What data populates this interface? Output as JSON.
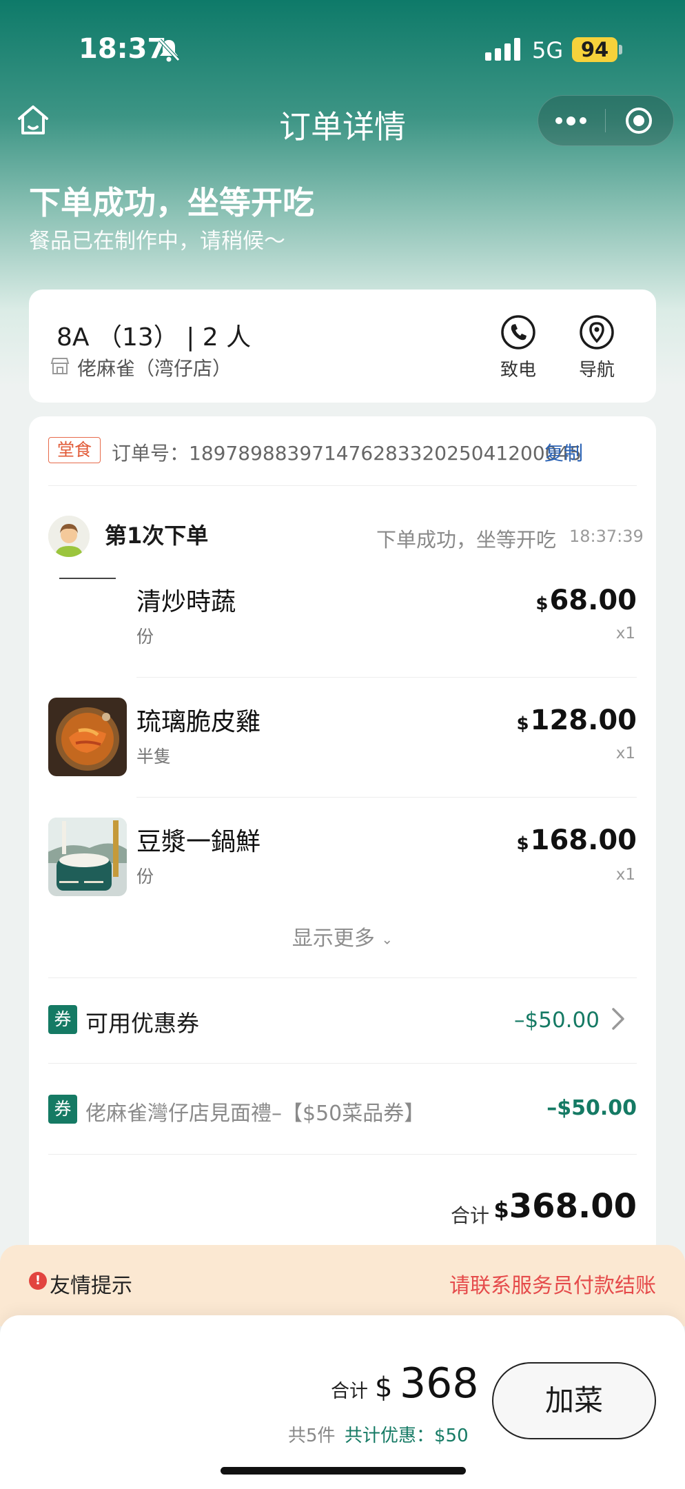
{
  "status_bar": {
    "time": "18:37",
    "network": "5G",
    "battery": "94"
  },
  "nav": {
    "title": "订单详情"
  },
  "header": {
    "title": "下单成功，坐等开吃",
    "subtitle": "餐品已在制作中，请稍候～"
  },
  "table": {
    "table_no": "8A （13） | 2 人",
    "store": "佬麻雀（湾仔店）",
    "call_label": "致电",
    "navigate_label": "导航"
  },
  "order": {
    "type_tag": "堂食",
    "order_no_label": "订单号：",
    "order_no": "18978988397147628332025041200045",
    "copy_label": "复制",
    "batch": {
      "title": "第1次下单",
      "status": "下单成功，坐等开吃",
      "time": "18:37:39"
    },
    "currency_symbol": "$",
    "items": [
      {
        "name": "清炒時蔬",
        "unit": "份",
        "price": "68.00",
        "qty": "x1"
      },
      {
        "name": "琉璃脆皮雞",
        "unit": "半隻",
        "price": "128.00",
        "qty": "x1"
      },
      {
        "name": "豆漿一鍋鮮",
        "unit": "份",
        "price": "168.00",
        "qty": "x1"
      }
    ],
    "show_more": "显示更多",
    "coupon": {
      "badge": "券",
      "title": "可用优惠券",
      "amount": "–$50.00"
    },
    "applied_coupon": {
      "badge": "券",
      "title": "佬麻雀灣仔店見面禮–【$50菜品券】",
      "amount": "–$50.00"
    },
    "subtotal_label": "合计",
    "subtotal": "368.00"
  },
  "reminder": {
    "title": "友情提示",
    "message": "请联系服务员付款结账"
  },
  "bottom_bar": {
    "total_label": "合计",
    "currency": "$",
    "total": "368",
    "count": "共5件",
    "discount": "共计优惠：$50",
    "add_button": "加菜"
  },
  "colors": {
    "brand_green": "#157a64",
    "warning_red": "#e54b4b",
    "order_tag": "#e15a37",
    "link_blue": "#2b63b5"
  }
}
